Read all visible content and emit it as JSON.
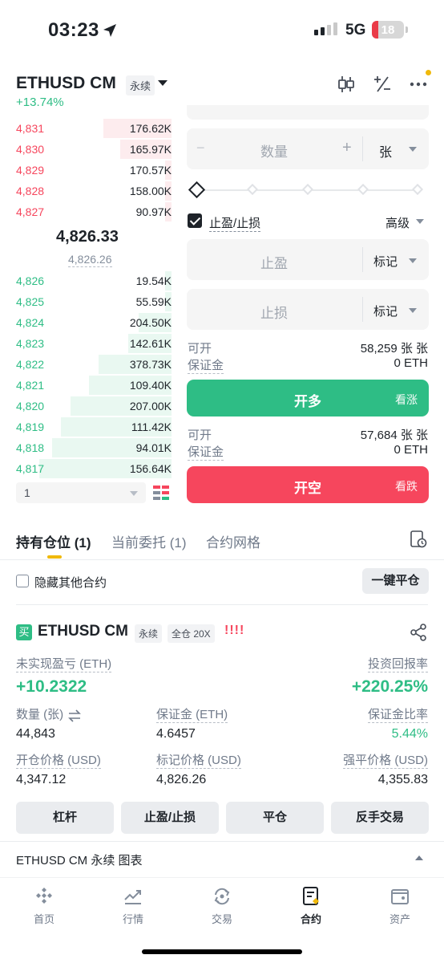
{
  "status": {
    "time": "03:23",
    "network": "5G",
    "battery": "18"
  },
  "header": {
    "pair": "ETHUSD CM",
    "perp_tag": "永续",
    "change": "+13.74%"
  },
  "order_book": {
    "asks": [
      {
        "price": "4,831",
        "qty": "176.62K",
        "depth": 0.44
      },
      {
        "price": "4,830",
        "qty": "165.97K",
        "depth": 0.33
      },
      {
        "price": "4,829",
        "qty": "170.57K",
        "depth": 0.04
      },
      {
        "price": "4,828",
        "qty": "158.00K",
        "depth": 0.04
      },
      {
        "price": "4,827",
        "qty": "90.97K",
        "depth": 0.04
      }
    ],
    "mid_price": "4,826.33",
    "mark_price": "4,826.26",
    "bids": [
      {
        "price": "4,826",
        "qty": "19.54K",
        "depth": 0.04
      },
      {
        "price": "4,825",
        "qty": "55.59K",
        "depth": 0.04
      },
      {
        "price": "4,824",
        "qty": "204.50K",
        "depth": 0.21
      },
      {
        "price": "4,823",
        "qty": "142.61K",
        "depth": 0.28
      },
      {
        "price": "4,822",
        "qty": "378.73K",
        "depth": 0.47
      },
      {
        "price": "4,821",
        "qty": "109.40K",
        "depth": 0.53
      },
      {
        "price": "4,820",
        "qty": "207.00K",
        "depth": 0.65
      },
      {
        "price": "4,819",
        "qty": "111.42K",
        "depth": 0.71
      },
      {
        "price": "4,818",
        "qty": "94.01K",
        "depth": 0.77
      },
      {
        "price": "4,817",
        "qty": "156.64K",
        "depth": 0.85
      }
    ],
    "precision": "1"
  },
  "order_form": {
    "qty_placeholder": "数量",
    "qty_unit": "张",
    "tpsl_label": "止盈/止损",
    "advanced_label": "高级",
    "tp_placeholder": "止盈",
    "sl_placeholder": "止损",
    "trigger_type": "标记",
    "long": {
      "avail_label": "可开",
      "avail_value": "58,259 张 张",
      "margin_label": "保证金",
      "margin_value": "0 ETH",
      "button": "开多",
      "button_sub": "看涨"
    },
    "short": {
      "avail_label": "可开",
      "avail_value": "57,684 张 张",
      "margin_label": "保证金",
      "margin_value": "0 ETH",
      "button": "开空",
      "button_sub": "看跌"
    }
  },
  "tabs": [
    {
      "label": "持有仓位 (1)"
    },
    {
      "label": "当前委托 (1)"
    },
    {
      "label": "合约网格"
    }
  ],
  "positions_toolbar": {
    "hide_label": "隐藏其他合约",
    "close_all": "一键平仓"
  },
  "position": {
    "side_badge": "买",
    "symbol": "ETHUSD CM",
    "perp_tag": "永续",
    "margin_tag": "全仓 20X",
    "warning": "!!!!",
    "pnl_label": "未实现盈亏 (ETH)",
    "pnl_value": "+10.2322",
    "roe_label": "投资回报率",
    "roe_value": "+220.25%",
    "size_label": "数量 (张)",
    "size_value": "44,843",
    "margin_label": "保证金 (ETH)",
    "margin_value": "4.6457",
    "margin_ratio_label": "保证金比率",
    "margin_ratio_value": "5.44%",
    "entry_label": "开仓价格 (USD)",
    "entry_value": "4,347.12",
    "mark_label": "标记价格 (USD)",
    "mark_value": "4,826.26",
    "liq_label": "强平价格 (USD)",
    "liq_value": "4,355.83",
    "actions": [
      "杠杆",
      "止盈/止损",
      "平仓",
      "反手交易"
    ]
  },
  "chart_bar": {
    "label": "ETHUSD CM 永续  图表"
  },
  "bottom_nav": [
    {
      "label": "首页",
      "icon": "home-icon"
    },
    {
      "label": "行情",
      "icon": "markets-icon"
    },
    {
      "label": "交易",
      "icon": "trade-icon"
    },
    {
      "label": "合约",
      "icon": "futures-icon",
      "active": true
    },
    {
      "label": "资产",
      "icon": "wallet-icon"
    }
  ]
}
